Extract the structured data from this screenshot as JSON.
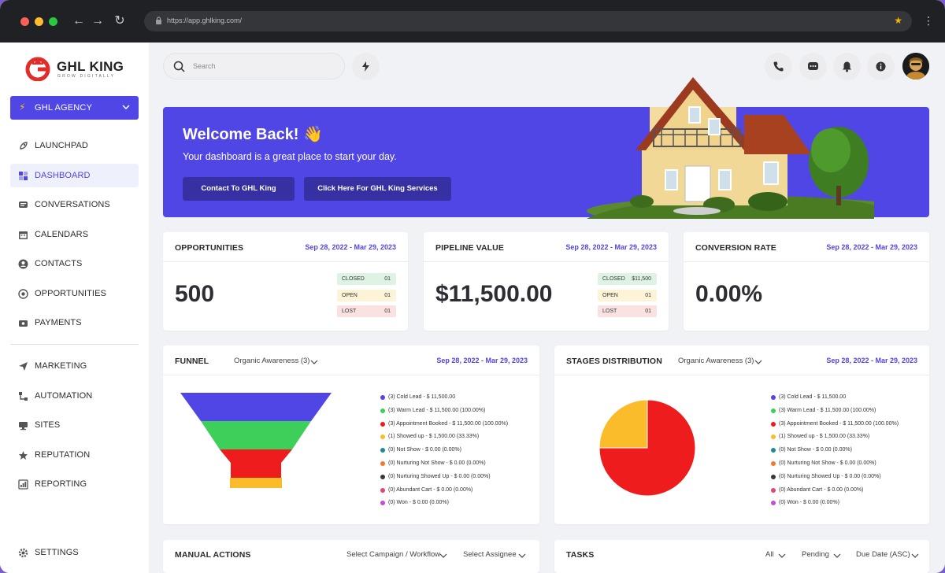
{
  "browser": {
    "url": "https://app.ghlking.com/"
  },
  "brand": {
    "name": "GHL KING",
    "tagline": "GROW DIGITALLY",
    "accent": "#4f46e5",
    "logo_red": "#e22c2c"
  },
  "agency": {
    "label": "GHL AGENCY"
  },
  "sidebar": {
    "items": [
      {
        "label": "LAUNCHPAD",
        "icon": "rocket-icon"
      },
      {
        "label": "DASHBOARD",
        "icon": "grid-icon",
        "active": true
      },
      {
        "label": "CONVERSATIONS",
        "icon": "chat-icon"
      },
      {
        "label": "CALENDARS",
        "icon": "calendar-icon"
      },
      {
        "label": "CONTACTS",
        "icon": "contacts-icon"
      },
      {
        "label": "OPPORTUNITIES",
        "icon": "target-icon"
      },
      {
        "label": "PAYMENTS",
        "icon": "payment-icon"
      },
      {
        "label": "MARKETING",
        "icon": "send-icon"
      },
      {
        "label": "AUTOMATION",
        "icon": "automation-icon"
      },
      {
        "label": "SITES",
        "icon": "sites-icon"
      },
      {
        "label": "REPUTATION",
        "icon": "star-icon"
      },
      {
        "label": "REPORTING",
        "icon": "chart-icon"
      }
    ],
    "settings": "SETTINGS"
  },
  "topbar": {
    "search_placeholder": "Search"
  },
  "banner": {
    "title": "Welcome Back! 👋",
    "subtitle": "Your dashboard is a great place to start your day.",
    "btn1": "Contact To GHL King",
    "btn2": "Click Here For GHL King Services"
  },
  "stats": {
    "opportunities": {
      "title": "OPPORTUNITIES",
      "date": "Sep 28, 2022 - Mar 29, 2023",
      "value": "500",
      "pills": [
        {
          "label": "CLOSED",
          "value": "01"
        },
        {
          "label": "OPEN",
          "value": "01"
        },
        {
          "label": "LOST",
          "value": "01"
        }
      ]
    },
    "pipeline": {
      "title": "PIPELINE VALUE",
      "date": "Sep 28, 2022 - Mar 29, 2023",
      "value": "$11,500.00",
      "pills": [
        {
          "label": "CLOSED",
          "value": "$11,500"
        },
        {
          "label": "OPEN",
          "value": "01"
        },
        {
          "label": "LOST",
          "value": "01"
        }
      ]
    },
    "conversion": {
      "title": "CONVERSION RATE",
      "date": "Sep 28, 2022 - Mar 29, 2023",
      "value": "0.00%"
    }
  },
  "funnel": {
    "title": "FUNNEL",
    "filter": "Organic Awareness (3)",
    "date": "Sep 28, 2022 - Mar 29, 2023"
  },
  "stages": {
    "title": "STAGES DISTRIBUTION",
    "filter": "Organic Awareness (3)",
    "date": "Sep 28, 2022 - Mar 29, 2023"
  },
  "legend": [
    {
      "text": "(3)  Cold Lead  -  $ 11,500.00",
      "color": "#4f46e5"
    },
    {
      "text": "(3)  Warm Lead  -  $ 11,500.00 (100.00%)",
      "color": "#3ecf5a"
    },
    {
      "text": "(3)  Appointment Booked  -  $ 11,500.00 (100.00%)",
      "color": "#ee1c1c"
    },
    {
      "text": "(1)  Showed up  -  $ 1,500.00 (33.33%)",
      "color": "#fbbc2c"
    },
    {
      "text": "(0)  Not Show  -  $ 0.00 (0.00%)",
      "color": "#1b8a9a"
    },
    {
      "text": "(0)  Nurturing Not Show  -  $ 0.00 (0.00%)",
      "color": "#ee7b2a"
    },
    {
      "text": "(0)  Nurturing Showed Up  -  $ 0.00 (0.00%)",
      "color": "#3a3a3a"
    },
    {
      "text": "(0)  Abundant Cart  -  $ 0.00 (0.00%)",
      "color": "#e0457b"
    },
    {
      "text": "(0)  Won  -  $ 0.00 (0.00%)",
      "color": "#c34fd6"
    }
  ],
  "chart_data": [
    {
      "type": "bar",
      "subtype": "funnel",
      "categories": [
        "Cold Lead",
        "Warm Lead",
        "Appointment Booked",
        "Showed up"
      ],
      "values": [
        3,
        3,
        3,
        1
      ],
      "colors": [
        "#4f46e5",
        "#3ecf5a",
        "#ee1c1c",
        "#fbbc2c"
      ]
    },
    {
      "type": "pie",
      "categories": [
        "Appointment Booked",
        "Showed up"
      ],
      "values": [
        3,
        1
      ],
      "colors": [
        "#ee1c1c",
        "#fbbc2c"
      ]
    }
  ],
  "manual_actions": {
    "title": "MANUAL ACTIONS",
    "campaign": "Select Campaign / Workflow",
    "assignee": "Select Assignee"
  },
  "tasks": {
    "title": "TASKS",
    "filter1": "All",
    "filter2": "Pending",
    "filter3": "Due Date (ASC)"
  }
}
